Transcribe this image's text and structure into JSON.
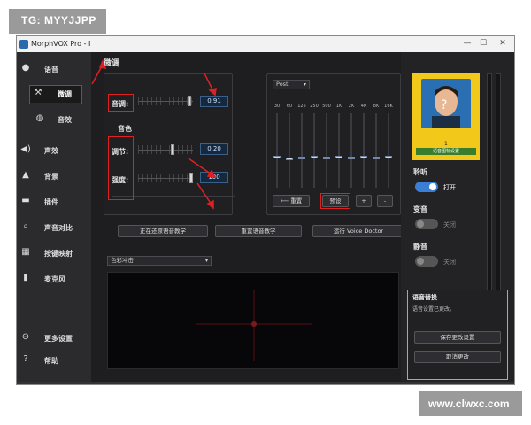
{
  "watermark_top": "TG: MYYJJPP",
  "watermark_bottom": "www.clwxc.com",
  "window": {
    "title": "MorphVOX Pro - I",
    "min": "—",
    "max": "☐",
    "close": "✕"
  },
  "sidebar": {
    "items": [
      {
        "label": "语音",
        "icon": "●"
      },
      {
        "label": "微调",
        "icon": "⚒"
      },
      {
        "label": "音效",
        "icon": "◍"
      },
      {
        "label": "声效",
        "icon": "◀)"
      },
      {
        "label": "背景",
        "icon": "▲"
      },
      {
        "label": "插件",
        "icon": "▬"
      },
      {
        "label": "声音对比",
        "icon": "⌕"
      },
      {
        "label": "按键映射",
        "icon": "▦"
      },
      {
        "label": "麦克风",
        "icon": "▮"
      },
      {
        "label": "更多设置",
        "icon": "⊖"
      },
      {
        "label": "帮助",
        "icon": "?"
      }
    ]
  },
  "main": {
    "title": "微调",
    "pitch": {
      "label": "音调:",
      "value": "0.91"
    },
    "timbre_group": "音色",
    "adjust": {
      "label": "调节:",
      "value": "0.20"
    },
    "strength": {
      "label": "强度:",
      "value": "100"
    },
    "eq": {
      "preset": "Post",
      "bands": [
        "30",
        "60",
        "125",
        "250",
        "500",
        "1K",
        "2K",
        "4K",
        "8K",
        "16K"
      ],
      "reset_btn": "重置",
      "preset_btn": "预设",
      "plus_btn": "+",
      "minus_btn": "-"
    },
    "buttons": [
      "正在还原语音教学",
      "重置语音教学",
      "运行 Voice Doctor"
    ],
    "viz_select": "色彩冲击"
  },
  "right": {
    "avatar_number": "1",
    "avatar_caption": "语音图标设置",
    "listen": {
      "label": "聆听",
      "state": "打开"
    },
    "change": {
      "label": "变音",
      "state": "关闭"
    },
    "mute": {
      "label": "静音",
      "state": "关闭"
    },
    "voice_panel": {
      "title": "语音替换",
      "status": "语音设置已更改。",
      "save_btn": "保存更改设置",
      "cancel_btn": "取消更改"
    }
  },
  "colors": {
    "accent_red": "#e02020",
    "toggle_on": "#3b7fd4",
    "avatar_bg": "#f2c81a"
  }
}
